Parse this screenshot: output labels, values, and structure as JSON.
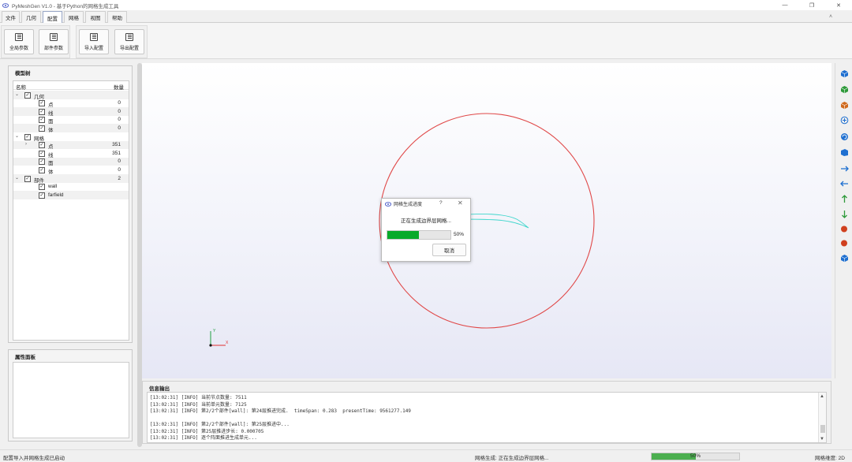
{
  "app": {
    "title": "PyMeshGen V1.0 - 基于Python的网格生成工具",
    "window_buttons": [
      "—",
      "❐",
      "✕"
    ],
    "collapse_label": "˄"
  },
  "menu": {
    "tabs": [
      "文件",
      "几何",
      "配置",
      "网格",
      "视图",
      "帮助"
    ],
    "active": "配置"
  },
  "ribbon": {
    "buttons": [
      "全局参数",
      "部件参数",
      "导入配置",
      "导出配置"
    ]
  },
  "tree": {
    "title": "模型树",
    "col_name": "名称",
    "col_count": "数量",
    "rows": [
      {
        "label": "几何",
        "count": "",
        "level": 0,
        "arrow": "v"
      },
      {
        "label": "点",
        "count": "0",
        "level": 1,
        "arrow": ""
      },
      {
        "label": "线",
        "count": "0",
        "level": 1,
        "arrow": ""
      },
      {
        "label": "面",
        "count": "0",
        "level": 1,
        "arrow": ""
      },
      {
        "label": "体",
        "count": "0",
        "level": 1,
        "arrow": ""
      },
      {
        "label": "网格",
        "count": "",
        "level": 0,
        "arrow": "v"
      },
      {
        "label": "点",
        "count": "351",
        "level": 1,
        "arrow": ">"
      },
      {
        "label": "线",
        "count": "351",
        "level": 1,
        "arrow": ""
      },
      {
        "label": "面",
        "count": "0",
        "level": 1,
        "arrow": ""
      },
      {
        "label": "体",
        "count": "0",
        "level": 1,
        "arrow": ""
      },
      {
        "label": "部件",
        "count": "2",
        "level": 0,
        "arrow": "v"
      },
      {
        "label": "wall",
        "count": "",
        "level": 1,
        "arrow": ""
      },
      {
        "label": "farfield",
        "count": "",
        "level": 1,
        "arrow": ""
      }
    ]
  },
  "properties": {
    "title": "属性面板"
  },
  "viewport": {
    "circle_color": "#e04848",
    "wall_color": "#3fd6cc",
    "axis": {
      "y": "Y",
      "x": "X"
    }
  },
  "dialog": {
    "title": "网格生成进度",
    "help": "?",
    "close": "✕",
    "message": "正在生成边界层网格...",
    "progress": 50,
    "progress_text": "50%",
    "cancel": "取消"
  },
  "right_toolbar": {
    "icons": [
      {
        "name": "view-iso-cube-icon",
        "color": "#1e6fd0"
      },
      {
        "name": "view-cube-green-icon",
        "color": "#2e9a3a"
      },
      {
        "name": "view-cube-orange-icon",
        "color": "#d06a1e"
      },
      {
        "name": "zoom-fit-icon",
        "color": "#1e6fd0"
      },
      {
        "name": "rotate-view-icon",
        "color": "#1e6fd0"
      },
      {
        "name": "view-front-icon",
        "color": "#1e6fd0"
      },
      {
        "name": "view-plus-x-icon",
        "color": "#1e6fd0"
      },
      {
        "name": "view-minus-x-icon",
        "color": "#1e6fd0"
      },
      {
        "name": "view-plus-y-icon",
        "color": "#2e9a3a"
      },
      {
        "name": "view-minus-y-icon",
        "color": "#2e9a3a"
      },
      {
        "name": "view-plus-z-icon",
        "color": "#d0401e"
      },
      {
        "name": "view-minus-z-icon",
        "color": "#d0401e"
      },
      {
        "name": "view-3d-icon",
        "color": "#1e6fd0"
      }
    ]
  },
  "output": {
    "title": "信息输出",
    "lines": [
      "[13:02:31] [INFO] 当前节点数量: 7511",
      "[13:02:31] [INFO] 当前单元数量: 7125",
      "[13:02:31] [INFO] 第2/2个部件[wall]: 第24层推进完成.  timeSpan: 0.283  presentTime: 9561277.149",
      "",
      "[13:02:31] [INFO] 第2/2个部件[wall]: 第25层推进中...",
      "[13:02:31] [INFO] 第25层推进步长: 0.000705",
      "[13:02:31] [INFO] 逐个阵面推进生成单元..."
    ]
  },
  "status": {
    "left": "配置导入并网格生成已启动",
    "middle": "网格生成: 正在生成边界层网格...",
    "progress": 50,
    "progress_text": "50%",
    "right": "网格维度: 2D"
  }
}
